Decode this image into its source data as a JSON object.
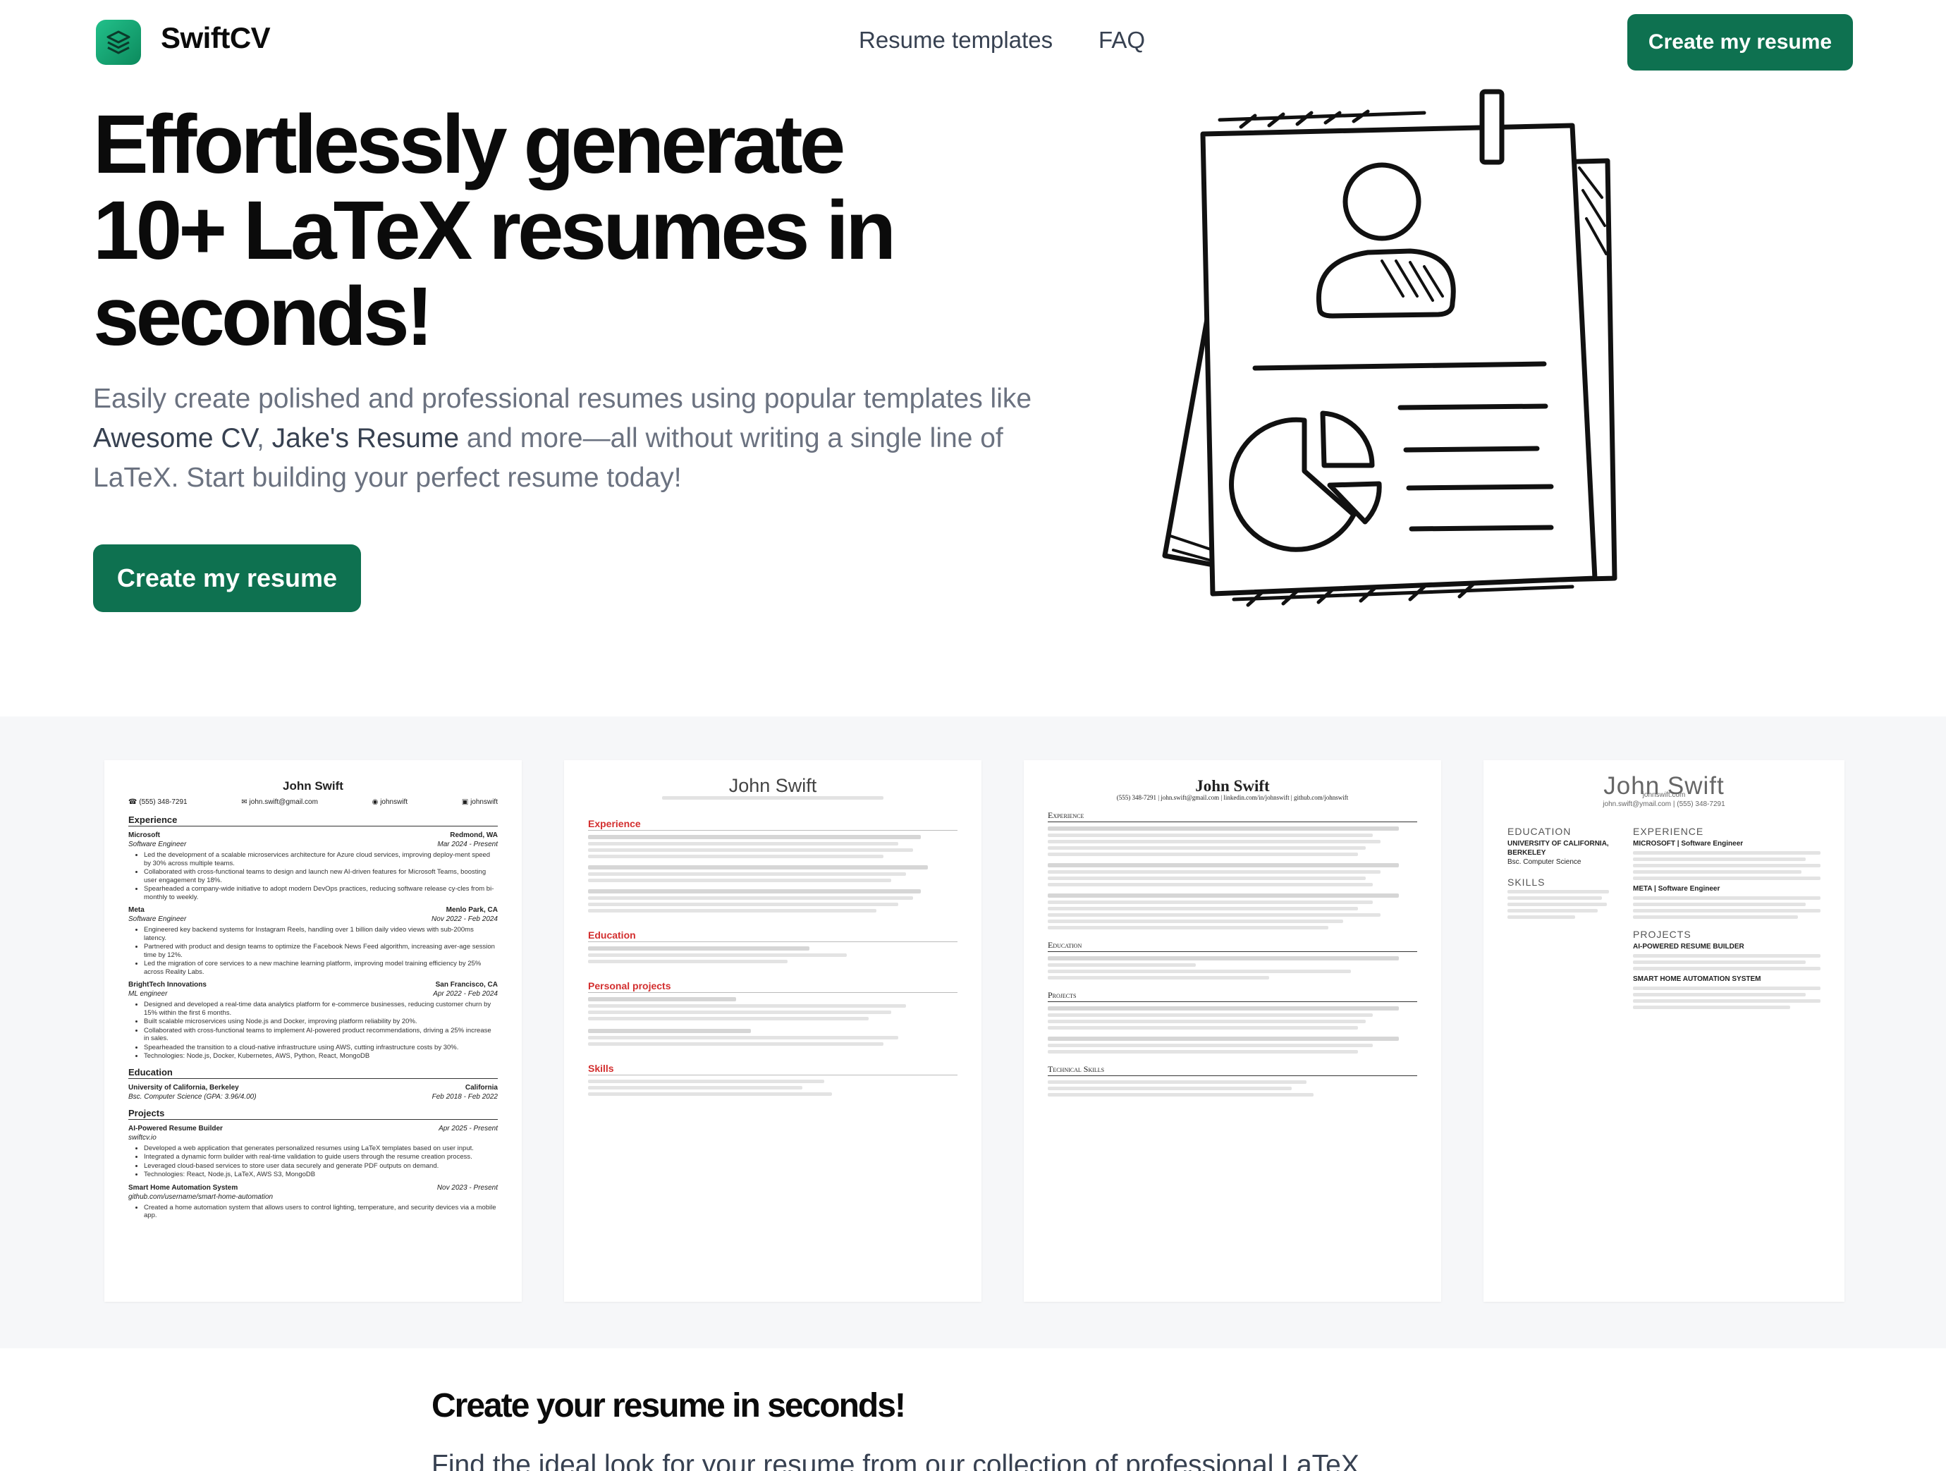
{
  "nav": {
    "brand": "SwiftCV",
    "links": [
      "Resume templates",
      "FAQ"
    ],
    "cta": "Create my resume"
  },
  "hero": {
    "title_lines": [
      "Effortlessly generate",
      "10+ LaTeX resumes in",
      "seconds!"
    ],
    "subtitle_pre": "Easily create polished and professional resumes using popular templates like ",
    "subtitle_em1": "Awesome CV",
    "subtitle_sep": ", ",
    "subtitle_em2": "Jake's Resume",
    "subtitle_post": " and more—all without writing a single line of LaTeX. Start building your perfect resume today!",
    "cta": "Create my resume"
  },
  "templates": {
    "jake": {
      "name": "John Swift",
      "contacts": [
        "(555) 348-7291",
        "john.swift@gmail.com",
        "johnswift",
        "johnswift"
      ],
      "sections": [
        "Experience",
        "Education",
        "Projects"
      ],
      "jobs": [
        {
          "company": "Microsoft",
          "location": "Redmond, WA",
          "title": "Software Engineer",
          "dates": "Mar 2024 - Present"
        },
        {
          "company": "Meta",
          "location": "Menlo Park, CA",
          "title": "Software Engineer",
          "dates": "Nov 2022 - Feb 2024"
        },
        {
          "company": "BrightTech Innovations",
          "location": "San Francisco, CA",
          "title": "ML engineer",
          "dates": "Apr 2022 - Feb 2024"
        }
      ],
      "bullets": [
        "Led the development of a scalable microservices architecture for Azure cloud services, improving deploy-ment speed by 30% across multiple teams.",
        "Collaborated with cross-functional teams to design and launch new AI-driven features for Microsoft Teams, boosting user engagement by 18%.",
        "Spearheaded a company-wide initiative to adopt modern DevOps practices, reducing software release cy-cles from bi-monthly to weekly.",
        "Engineered key backend systems for Instagram Reels, handling over 1 billion daily video views with sub-200ms latency.",
        "Partnered with product and design teams to optimize the Facebook News Feed algorithm, increasing aver-age session time by 12%.",
        "Led the migration of core services to a new machine learning platform, improving model training efficiency by 25% across Reality Labs.",
        "Designed and developed a real-time data analytics platform for e-commerce businesses, reducing customer churn by 15% within the first 6 months.",
        "Built scalable microservices using Node.js and Docker, improving platform reliability by 20%.",
        "Collaborated with cross-functional teams to implement AI-powered product recommendations, driving a 25% increase in sales.",
        "Spearheaded the transition to a cloud-native infrastructure using AWS, cutting infrastructure costs by 30%.",
        "Technologies: Node.js, Docker, Kubernetes, AWS, Python, React, MongoDB"
      ],
      "school": "University of California, Berkeley",
      "school_loc": "California",
      "degree": "Bsc. Computer Science (GPA: 3.96/4.00)",
      "school_dates": "Feb 2018 - Feb 2022",
      "project1": "AI-Powered Resume Builder",
      "project1_dates": "Apr 2025 - Present",
      "project1_link": "swiftcv.io",
      "project1_bullets": [
        "Developed a web application that generates personalized resumes using LaTeX templates based on user input.",
        "Integrated a dynamic form builder with real-time validation to guide users through the resume creation process.",
        "Leveraged cloud-based services to store user data securely and generate PDF outputs on demand.",
        "Technologies: React, Node.js, LaTeX, AWS S3, MongoDB"
      ],
      "project2": "Smart Home Automation System",
      "project2_dates": "Nov 2023 - Present",
      "project2_link": "github.com/username/smart-home-automation",
      "project2_bullets": [
        "Created a home automation system that allows users to control lighting, temperature, and security devices via a mobile app."
      ]
    },
    "awesome": {
      "name": "John Swift",
      "sections": [
        "Experience",
        "Education",
        "Personal projects",
        "Skills"
      ]
    },
    "classic": {
      "name": "John Swift",
      "contacts": "(555) 348-7291 | john.swift@gmail.com | linkedin.com/in/johnswift | github.com/johnswift",
      "sections": [
        "Experience",
        "Education",
        "Projects",
        "Technical Skills"
      ]
    },
    "modern": {
      "name": "John Swift",
      "contact_lines": [
        "johnswift.com",
        "john.swift@ymail.com | (555) 348-7291"
      ],
      "left_heads": [
        "EDUCATION",
        "SKILLS"
      ],
      "right_heads": [
        "EXPERIENCE",
        "PROJECTS"
      ],
      "edu": "UNIVERSITY OF CALIFORNIA, BERKELEY",
      "edu_deg": "Bsc. Computer Science",
      "job1": "MICROSOFT | Software Engineer",
      "job2": "META | Software Engineer",
      "proj1": "AI-POWERED RESUME BUILDER",
      "proj2": "SMART HOME AUTOMATION SYSTEM"
    }
  },
  "bottom": {
    "title": "Create your resume in seconds!",
    "subtitle": "Find the ideal look for your resume from our collection of professional LaTeX"
  }
}
